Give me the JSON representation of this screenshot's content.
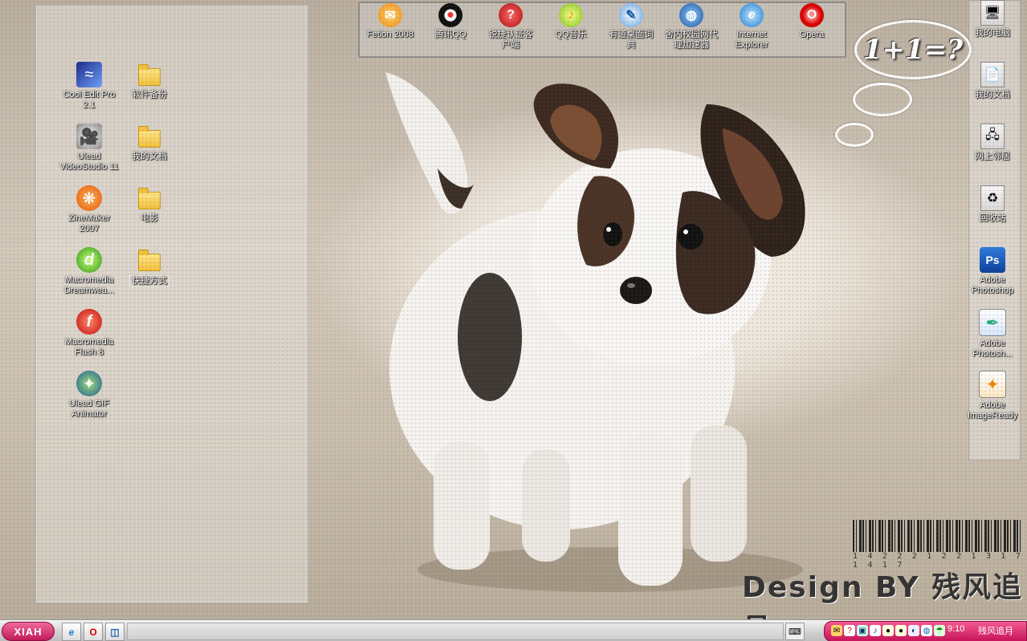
{
  "dock": {
    "items": [
      {
        "label": "Fetion 2008",
        "icon": "fetion-icon"
      },
      {
        "label": "腾讯QQ",
        "icon": "qq-penguin-icon"
      },
      {
        "label": "锐捷认证客户端",
        "icon": "ruijie-icon"
      },
      {
        "label": "QQ音乐",
        "icon": "qq-music-icon"
      },
      {
        "label": "有道桌面词典",
        "icon": "youdao-dict-icon"
      },
      {
        "label": "舍内校园网代理加速器",
        "icon": "network-globe-icon"
      },
      {
        "label": "Internet Explorer",
        "icon": "internet-explorer-icon"
      },
      {
        "label": "Opera",
        "icon": "opera-icon"
      }
    ]
  },
  "left_icons": [
    {
      "label": "Cool Edit Pro 2.1",
      "icon": "cool-edit-icon"
    },
    {
      "label": "软件备份",
      "icon": "folder-icon"
    },
    {
      "label": "Ulead VideoStudio 11",
      "icon": "video-studio-icon"
    },
    {
      "label": "我的文档",
      "icon": "folder-icon"
    },
    {
      "label": "ZineMaker 2007",
      "icon": "zinemaker-icon"
    },
    {
      "label": "电影",
      "icon": "folder-icon"
    },
    {
      "label": "Macromedia Dreamwea...",
      "icon": "dreamweaver-icon"
    },
    {
      "label": "快捷方式",
      "icon": "folder-icon"
    },
    {
      "label": "Macromedia Flash 8",
      "icon": "flash-icon"
    },
    {
      "label": "Ulead GIF Animator",
      "icon": "gif-animator-icon"
    }
  ],
  "right_icons": [
    {
      "label": "我的电脑",
      "icon": "my-computer-icon"
    },
    {
      "label": "我的文档",
      "icon": "my-documents-icon"
    },
    {
      "label": "网上邻居",
      "icon": "network-places-icon"
    },
    {
      "label": "回收站",
      "icon": "recycle-bin-icon"
    },
    {
      "label": "Adobe Photoshop",
      "icon": "photoshop-icon"
    },
    {
      "label": "Adobe Photosh...",
      "icon": "photoshop-alt-icon"
    },
    {
      "label": "Adobe ImageReady",
      "icon": "imageready-icon"
    }
  ],
  "wallpaper": {
    "bubble_text": "1+1=?",
    "barcode_number": "1 4 2 2 2 1 2 2 1 3 1 7 1 4 1 7",
    "design_text": "Design BY 残风追月"
  },
  "taskbar": {
    "start_label": "XIAH",
    "clock": "9:10",
    "tray_user": "残风追月",
    "colors": {
      "accent": "#d3246a",
      "taskbar_bg": "#d8d8d8"
    }
  }
}
